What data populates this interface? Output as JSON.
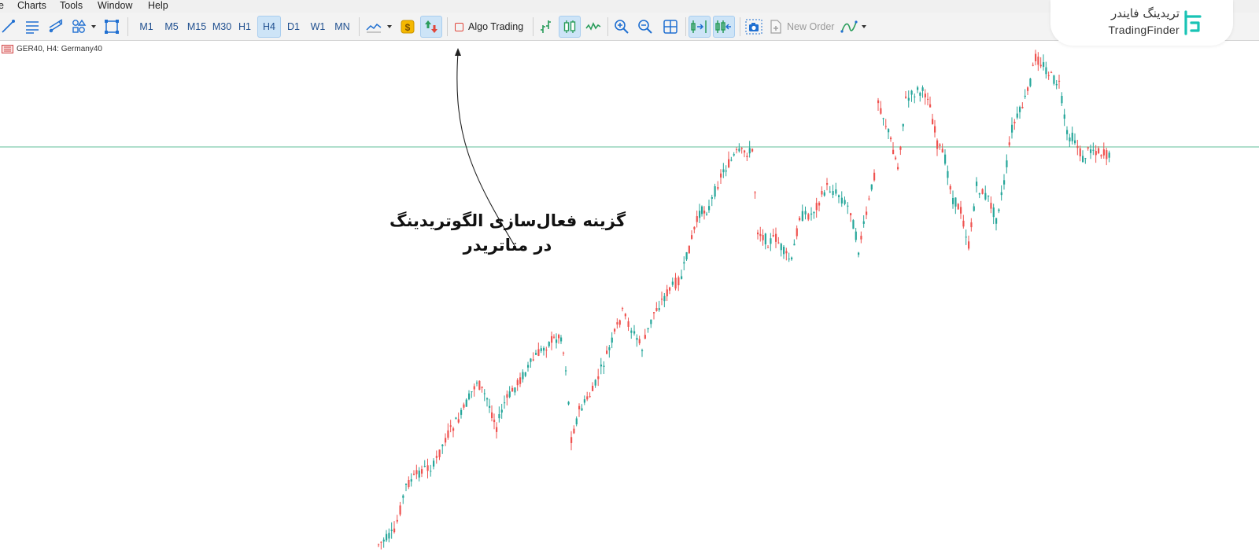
{
  "menu": {
    "items": [
      {
        "id": "charts",
        "label": "Charts"
      },
      {
        "id": "tools",
        "label": "Tools"
      },
      {
        "id": "window",
        "label": "Window"
      },
      {
        "id": "help",
        "label": "Help"
      }
    ]
  },
  "toolbar": {
    "timeframes": [
      {
        "label": "M1",
        "active": false
      },
      {
        "label": "M5",
        "active": false
      },
      {
        "label": "M15",
        "active": false
      },
      {
        "label": "M30",
        "active": false
      },
      {
        "label": "H1",
        "active": false
      },
      {
        "label": "H4",
        "active": true
      },
      {
        "label": "D1",
        "active": false
      },
      {
        "label": "W1",
        "active": false
      },
      {
        "label": "MN",
        "active": false
      }
    ],
    "algo_trading_label": "Algo Trading",
    "new_order_label": "New Order"
  },
  "chart": {
    "label": "GER40, H4:  Germany40",
    "horizontal_level": 0.6
  },
  "logo": {
    "name_fa": "تریدینگ فایندر",
    "name_en": "TradingFinder"
  },
  "annotation": {
    "line1": "گزینه فعال‌سازی الگوتریدینگ",
    "line2": "در متاتریدر"
  },
  "colors": {
    "bull": "#26a69a",
    "bear": "#ef5350",
    "level_line": "#5fbf9a",
    "accent": "#1f6fd1",
    "logo_teal": "#19c3b5"
  }
}
